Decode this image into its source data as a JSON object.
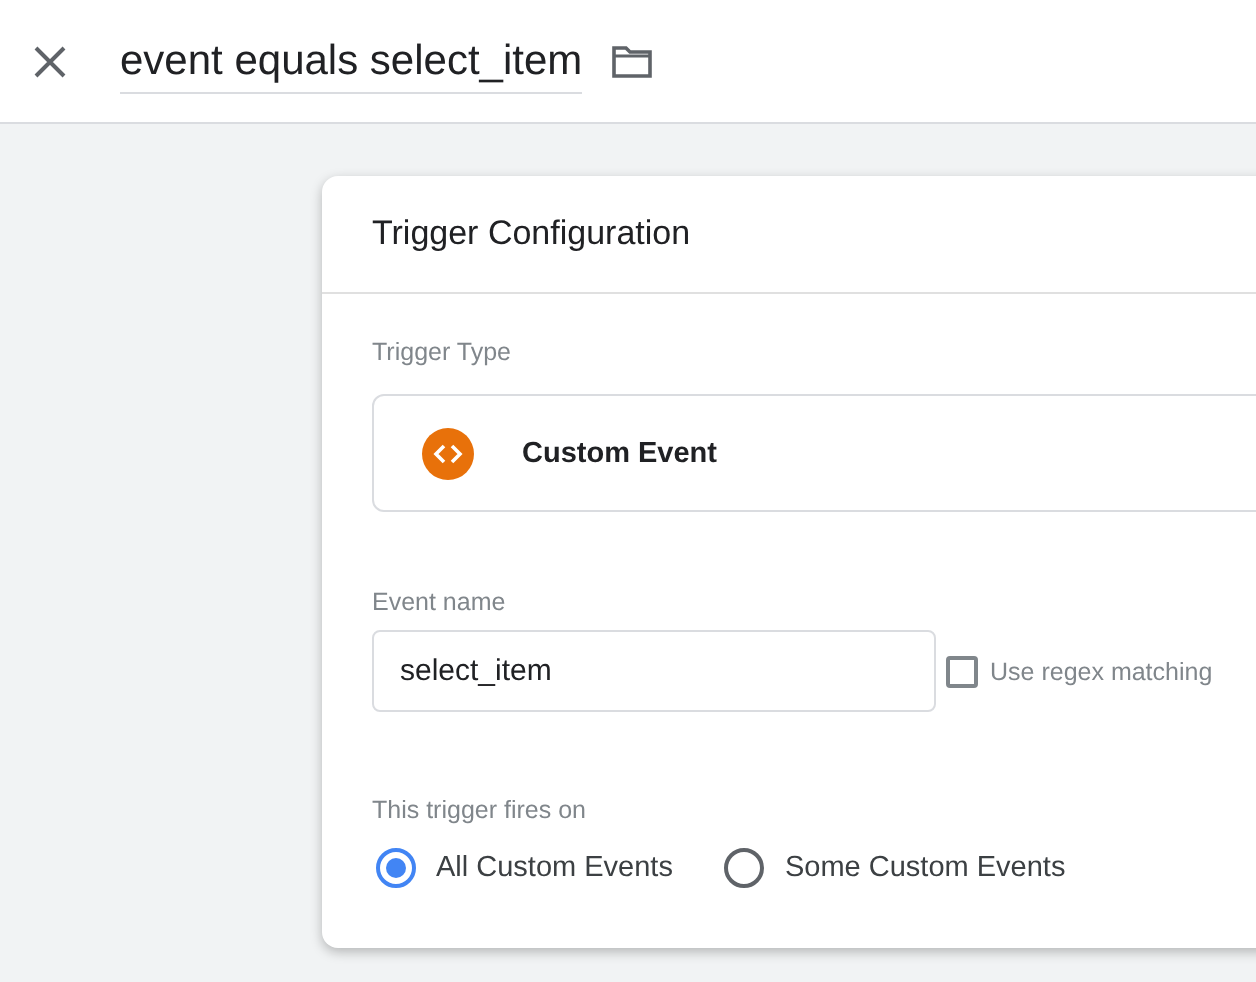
{
  "header": {
    "title": "event equals select_item"
  },
  "card": {
    "title": "Trigger Configuration",
    "trigger_type": {
      "label": "Trigger Type",
      "value": "Custom Event"
    },
    "event_name": {
      "label": "Event name",
      "value": "select_item"
    },
    "regex": {
      "label": "Use regex matching",
      "checked": false
    },
    "fires_on": {
      "label": "This trigger fires on",
      "options": [
        {
          "label": "All Custom Events",
          "selected": true
        },
        {
          "label": "Some Custom Events",
          "selected": false
        }
      ]
    }
  }
}
